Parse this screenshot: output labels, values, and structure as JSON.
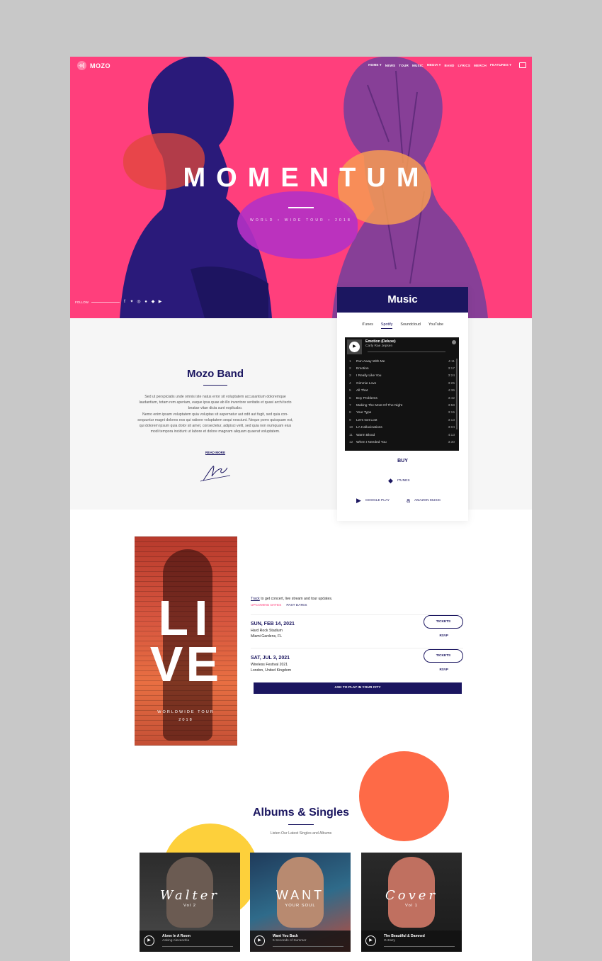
{
  "header": {
    "logo_text": "MOZO",
    "nav": [
      "HOME ▾",
      "NEWS",
      "TOUR",
      "MUSIC",
      "MEDIA ▾",
      "BAND",
      "LYRICS",
      "MERCH",
      "FEATURES ▾"
    ]
  },
  "hero": {
    "title": "MOMENTUM",
    "subtitle": "WORLD • WIDE TOUR • 2018",
    "follow_label": "FOLLOW",
    "social_icons": [
      "facebook-icon",
      "twitter-icon",
      "instagram-icon",
      "spotify-icon",
      "apple-icon",
      "youtube-icon"
    ]
  },
  "about": {
    "title": "Mozo Band",
    "paragraph1": "Sed ut perspiciatis unde omnis iste natus error sit voluptatem accusantium doloremque laudantium, totam rem aperiam, eaque ipsa quae ab illo inventore veritatis et quasi archi tecto beatae vitae dicta sunt explicabo.",
    "paragraph2": "Nemo enim ipsam voluptatem quia voluptas sit aspernatur aut odit aut fugit, sed quia con-sequuntur magni dolores eos qui ratione voluptatem sequi nesciunt. Neque porro quisquam est, qui dolorem ipsum quia dolor sit amet, consectetur, adipisci velit, sed quia non numquam eius modi tempora incidunt ut labore et dolore magnam aliquam quaerat voluptatem.",
    "read_more": "READ MORE"
  },
  "music": {
    "title": "Music",
    "tabs": [
      "iTunes",
      "Spotify",
      "Soundcloud",
      "YouTube"
    ],
    "active_tab": "Spotify",
    "player": {
      "album": "Emotion (Deluxe)",
      "artist": "Carly Rae Jepsen",
      "tracks": [
        {
          "n": "1",
          "title": "Run Away With Me",
          "dur": "4:11"
        },
        {
          "n": "2",
          "title": "Emotion",
          "dur": "3:17"
        },
        {
          "n": "3",
          "title": "I Really Like You",
          "dur": "3:24"
        },
        {
          "n": "4",
          "title": "Gimmie Love",
          "dur": "3:25"
        },
        {
          "n": "5",
          "title": "All That",
          "dur": "4:36"
        },
        {
          "n": "6",
          "title": "Boy Problems",
          "dur": "3:42"
        },
        {
          "n": "7",
          "title": "Making The Most Of The Night",
          "dur": "3:58"
        },
        {
          "n": "8",
          "title": "Your Type",
          "dur": "3:15"
        },
        {
          "n": "9",
          "title": "Let's Get Lost",
          "dur": "3:13"
        },
        {
          "n": "10",
          "title": "LA Hallucinations",
          "dur": "3:04"
        },
        {
          "n": "11",
          "title": "Warm Blood",
          "dur": "4:13"
        },
        {
          "n": "12",
          "title": "When I Needed You",
          "dur": "3:30"
        }
      ]
    },
    "buy_title": "BUY",
    "buy_links": {
      "itunes": "ITUNES",
      "google": "GOOGLE PLAY",
      "amazon": "AMAZON MUSIC"
    }
  },
  "live": {
    "poster_line1": "LI",
    "poster_line2": "VE",
    "poster_sub": "WORLDWIDE TOUR",
    "poster_year": "2018",
    "track_link": "Track",
    "track_text": " to get concert, live stream and tour updates.",
    "tab_upcoming": "UPCOMING DATES",
    "tab_past": "PAST DATES",
    "events": [
      {
        "date": "SUN, FEB 14, 2021",
        "venue": "Hard Rock Stadium",
        "location": "Miami Gardens, FL",
        "tickets": "TICKETS",
        "rsvp": "RSVP"
      },
      {
        "date": "SAT, JUL 3, 2021",
        "venue": "Wireless Festival 2021",
        "location": "London, United Kingdom",
        "tickets": "TICKETS",
        "rsvp": "RSVP"
      }
    ],
    "ask_button": "ASK TO PLAY IN YOUR CITY"
  },
  "albums": {
    "title": "Albums & Singles",
    "subtitle": "Listen Our Latest Singles and Albums",
    "items": [
      {
        "cover_title": "Walter",
        "vol": "Vol 2",
        "track": "Alone In A Room",
        "artist": "Asking Alexandria"
      },
      {
        "cover_title": "WANT",
        "vol": "YOUR SOUL",
        "track": "Want You Back",
        "artist": "5 Seconds of Summer"
      },
      {
        "cover_title": "Cover",
        "vol": "Vol 1",
        "track": "The Beautiful & Damned",
        "artist": "G-Eazy"
      }
    ]
  },
  "colors": {
    "accent": "#ff3f7c",
    "navy": "#1b1660",
    "orange": "#fe6a47",
    "yellow": "#fdd03b"
  }
}
